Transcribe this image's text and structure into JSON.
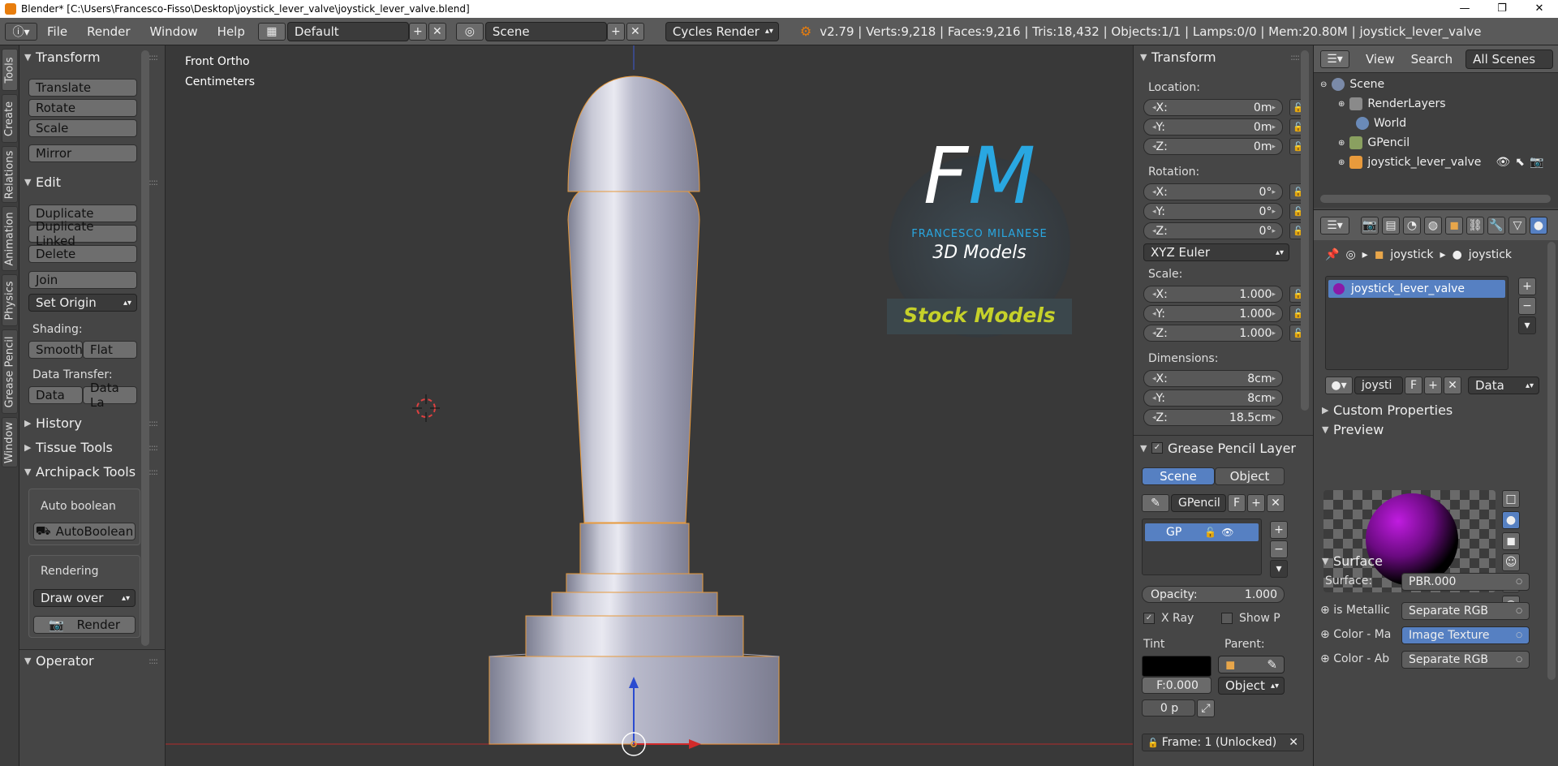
{
  "window": {
    "title": "Blender* [C:\\Users\\Francesco-Fisso\\Desktop\\joystick_lever_valve\\joystick_lever_valve.blend]"
  },
  "infobar": {
    "menus": [
      "File",
      "Render",
      "Window",
      "Help"
    ],
    "layout": "Default",
    "scene": "Scene",
    "engine": "Cycles Render",
    "stats": "v2.79 | Verts:9,218 | Faces:9,216 | Tris:18,432 | Objects:1/1 | Lamps:0/0 | Mem:20.80M | joystick_lever_valve"
  },
  "vtabs": [
    "Tools",
    "Create",
    "Relations",
    "Animation",
    "Physics",
    "Grease Pencil",
    "Window"
  ],
  "toolshelf": {
    "transform": {
      "title": "Transform",
      "buttons": [
        "Translate",
        "Rotate",
        "Scale",
        "Mirror"
      ]
    },
    "edit": {
      "title": "Edit",
      "buttons": [
        "Duplicate",
        "Duplicate Linked",
        "Delete",
        "Join"
      ],
      "set_origin": "Set Origin",
      "shading_label": "Shading:",
      "smooth": "Smooth",
      "flat": "Flat",
      "data_transfer_label": "Data Transfer:",
      "data": "Data",
      "data_la": "Data La"
    },
    "history": "History",
    "tissue": "Tissue Tools",
    "archipack": "Archipack Tools",
    "auto_boolean_label": "Auto boolean",
    "auto_boolean_btn": "AutoBoolean",
    "rendering_label": "Rendering",
    "draw_over": "Draw over",
    "render_btn": "Render",
    "operator": "Operator"
  },
  "viewport": {
    "view_name": "Front Ortho",
    "units": "Centimeters",
    "logo": {
      "letters_f": "F",
      "letters_m": "M",
      "name": "FRANCESCO MILANESE",
      "sub": "3D Models",
      "stock": "Stock Models"
    }
  },
  "npanel": {
    "title": "Transform",
    "location_label": "Location:",
    "location": [
      {
        "k": "X:",
        "v": "0m"
      },
      {
        "k": "Y:",
        "v": "0m"
      },
      {
        "k": "Z:",
        "v": "0m"
      }
    ],
    "rotation_label": "Rotation:",
    "rotation": [
      {
        "k": "X:",
        "v": "0°"
      },
      {
        "k": "Y:",
        "v": "0°"
      },
      {
        "k": "Z:",
        "v": "0°"
      }
    ],
    "rotation_mode": "XYZ Euler",
    "scale_label": "Scale:",
    "scale": [
      {
        "k": "X:",
        "v": "1.000"
      },
      {
        "k": "Y:",
        "v": "1.000"
      },
      {
        "k": "Z:",
        "v": "1.000"
      }
    ],
    "dimensions_label": "Dimensions:",
    "dimensions": [
      {
        "k": "X:",
        "v": "8cm"
      },
      {
        "k": "Y:",
        "v": "8cm"
      },
      {
        "k": "Z:",
        "v": "18.5cm"
      }
    ],
    "gp_title": "Grease Pencil Layer",
    "gp_scene": "Scene",
    "gp_object": "Object",
    "gp_name": "GPencil",
    "gp_f": "F",
    "gp_layer": "GP",
    "opacity_label": "Opacity:",
    "opacity": "1.000",
    "xray": "X Ray",
    "showp": "Show P",
    "tint": "Tint",
    "parent": "Parent:",
    "f_value": "F:0.000",
    "parent_type": "Object",
    "thickness": "0 p",
    "frame": "Frame: 1 (Unlocked)"
  },
  "outliner": {
    "view": "View",
    "search": "Search",
    "all_scenes": "All Scenes",
    "items": [
      "Scene",
      "RenderLayers",
      "World",
      "GPencil",
      "joystick_lever_valve"
    ]
  },
  "properties": {
    "breadcrumb": [
      "joystick",
      "joystick"
    ],
    "material": "joystick_lever_valve",
    "mat_name": "joysti",
    "mat_f": "F",
    "data_mode": "Data",
    "custom_props": "Custom Properties",
    "preview": "Preview",
    "surface": "Surface",
    "surface_label": "Surface:",
    "surface_val": "PBR.000",
    "rows": [
      {
        "label": "is Metallic",
        "val": "Separate RGB"
      },
      {
        "label": "Color - Ma",
        "val": "Image Texture"
      },
      {
        "label": "Color - Ab",
        "val": "Separate RGB"
      }
    ]
  },
  "colors": {
    "accent_blue": "#5680c2",
    "logo_blue": "#29a7e1",
    "logo_yellow": "#c6d12a",
    "selection_orange": "#e89a3c"
  }
}
